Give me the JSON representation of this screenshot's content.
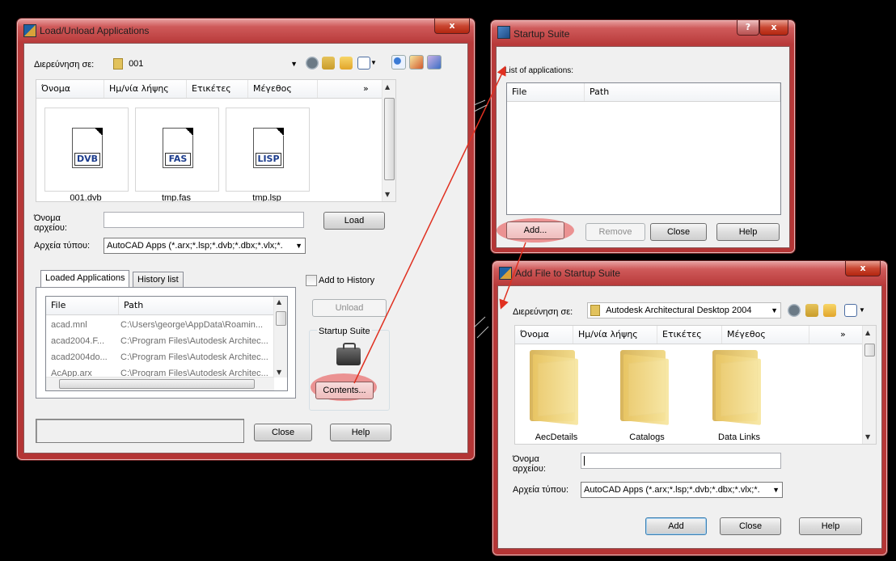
{
  "load_dialog": {
    "title": "Load/Unload Applications",
    "close_btn": "x",
    "look_in_label": "Διερεύνηση σε:",
    "look_in_value": "001",
    "columns": [
      "Όνομα",
      "Ημ/νία λήψης",
      "Ετικέτες",
      "Μέγεθος",
      "»"
    ],
    "files": [
      {
        "name": "001.dvb",
        "badge": "DVB"
      },
      {
        "name": "tmp.fas",
        "badge": "FAS"
      },
      {
        "name": "tmp.lsp",
        "badge": "LISP"
      }
    ],
    "filename_label": "Όνομα αρχείου:",
    "filetype_label": "Αρχεία τύπου:",
    "filetype_value": "AutoCAD Apps (*.arx;*.lsp;*.dvb;*.dbx;*.vlx;*.",
    "load_btn": "Load",
    "tabs": [
      "Loaded Applications",
      "History list"
    ],
    "add_to_history": "Add to History",
    "list_columns": [
      "File",
      "Path"
    ],
    "loaded_apps": [
      {
        "file": "acad.mnl",
        "path": "C:\\Users\\george\\AppData\\Roamin..."
      },
      {
        "file": "acad2004.F...",
        "path": "C:\\Program Files\\Autodesk Architec..."
      },
      {
        "file": "acad2004do...",
        "path": "C:\\Program Files\\Autodesk Architec..."
      },
      {
        "file": "AcApp.arx",
        "path": "C:\\Program Files\\Autodesk Architec..."
      }
    ],
    "unload_btn": "Unload",
    "startup_suite_label": "Startup Suite",
    "contents_btn": "Contents...",
    "close_button": "Close",
    "help_button": "Help"
  },
  "startup_dialog": {
    "title": "Startup Suite",
    "help_btn": "?",
    "close_btn": "x",
    "list_label": "List of applications:",
    "columns": [
      "File",
      "Path"
    ],
    "add_btn": "Add...",
    "remove_btn": "Remove",
    "close_button": "Close",
    "help_button": "Help"
  },
  "addfile_dialog": {
    "title": "Add File to Startup Suite",
    "close_btn": "x",
    "look_in_label": "Διερεύνηση σε:",
    "look_in_value": "Autodesk Architectural Desktop 2004",
    "columns": [
      "Όνομα",
      "Ημ/νία λήψης",
      "Ετικέτες",
      "Μέγεθος",
      "»"
    ],
    "folders": [
      "AecDetails",
      "Catalogs",
      "Data Links"
    ],
    "filename_label": "Όνομα αρχείου:",
    "filetype_label": "Αρχεία τύπου:",
    "filetype_value": "AutoCAD Apps (*.arx;*.lsp;*.dvb;*.dbx;*.vlx;*.",
    "add_btn": "Add",
    "close_button": "Close",
    "help_button": "Help"
  },
  "colors": {
    "frame": "#b83a3a",
    "client": "#f0f0f0",
    "highlight": "#e86060",
    "arrow": "#e03020"
  }
}
